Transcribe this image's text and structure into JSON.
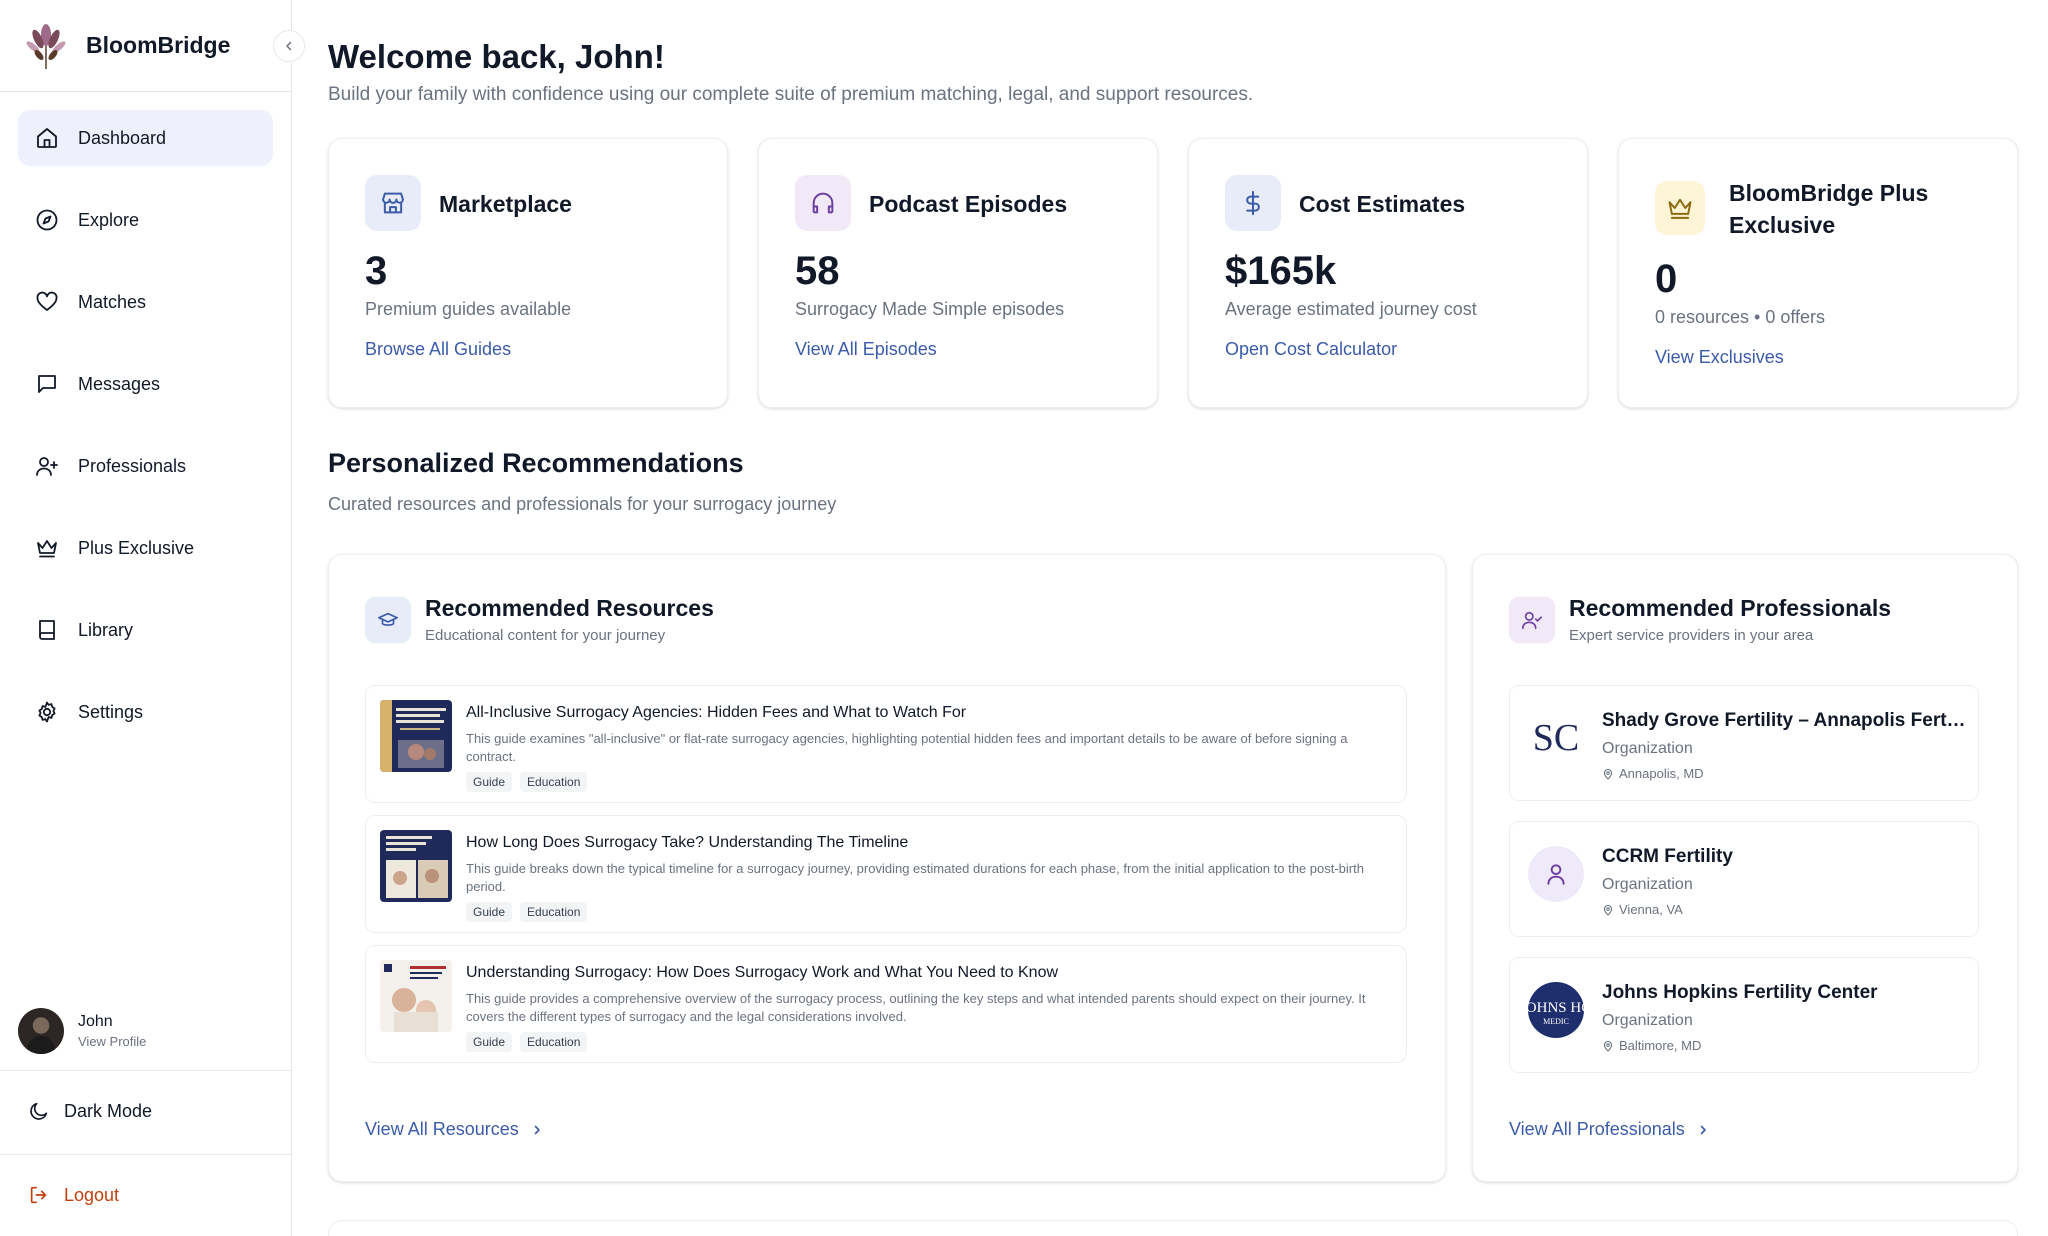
{
  "brand": {
    "name": "BloomBridge"
  },
  "nav": [
    {
      "label": "Dashboard",
      "icon": "home-icon",
      "active": true
    },
    {
      "label": "Explore",
      "icon": "compass-icon"
    },
    {
      "label": "Matches",
      "icon": "heart-icon"
    },
    {
      "label": "Messages",
      "icon": "message-icon"
    },
    {
      "label": "Professionals",
      "icon": "user-plus-icon"
    },
    {
      "label": "Plus Exclusive",
      "icon": "crown-icon"
    },
    {
      "label": "Library",
      "icon": "book-icon"
    },
    {
      "label": "Settings",
      "icon": "gear-icon"
    }
  ],
  "profile": {
    "name": "John",
    "sub": "View Profile"
  },
  "dark_mode_label": "Dark Mode",
  "logout_label": "Logout",
  "header": {
    "title": "Welcome back, John!",
    "subtitle": "Build your family with confidence using our complete suite of premium matching, legal, and support resources."
  },
  "stats": [
    {
      "title": "Marketplace",
      "value": "3",
      "desc": "Premium guides available",
      "link": "Browse All Guides",
      "icon": "store-icon"
    },
    {
      "title": "Podcast Episodes",
      "value": "58",
      "desc": "Surrogacy Made Simple episodes",
      "link": "View All Episodes",
      "icon": "headphones-icon"
    },
    {
      "title": "Cost Estimates",
      "value": "$165k",
      "desc": "Average estimated journey cost",
      "link": "Open Cost Calculator",
      "icon": "dollar-icon"
    },
    {
      "title": "BloomBridge Plus Exclusive",
      "value": "0",
      "desc": "0 resources • 0 offers",
      "link": "View Exclusives",
      "icon": "crown-icon"
    }
  ],
  "recommendations": {
    "title": "Personalized Recommendations",
    "subtitle": "Curated resources and professionals for your surrogacy journey"
  },
  "resources": {
    "title": "Recommended Resources",
    "subtitle": "Educational content for your journey",
    "items": [
      {
        "title": "All-Inclusive Surrogacy Agencies: Hidden Fees and What to Watch For",
        "desc": "This guide examines \"all-inclusive\" or flat-rate surrogacy agencies, highlighting potential hidden fees and important details to be aware of before signing a contract.",
        "tags": [
          "Guide",
          "Education"
        ]
      },
      {
        "title": "How Long Does Surrogacy Take? Understanding The Timeline",
        "desc": "This guide breaks down the typical timeline for a surrogacy journey, providing estimated durations for each phase, from the initial application to the post-birth period.",
        "tags": [
          "Guide",
          "Education"
        ]
      },
      {
        "title": "Understanding Surrogacy: How Does Surrogacy Work and What You Need to Know",
        "desc": "This guide provides a comprehensive overview of the surrogacy process, outlining the key steps and what intended parents should expect on their journey. It covers the different types of surrogacy and the legal considerations involved.",
        "tags": [
          "Guide",
          "Education"
        ]
      }
    ],
    "link": "View All Resources"
  },
  "professionals": {
    "title": "Recommended Professionals",
    "subtitle": "Expert service providers in your area",
    "items": [
      {
        "name": "Shady Grove Fertility – Annapolis Fertility Center",
        "type": "Organization",
        "location": "Annapolis, MD",
        "logo_text": "SC"
      },
      {
        "name": "CCRM Fertility",
        "type": "Organization",
        "location": "Vienna, VA"
      },
      {
        "name": "Johns Hopkins Fertility Center",
        "type": "Organization",
        "location": "Baltimore, MD",
        "logo_text": "JOHNS HO",
        "logo_sub": "MEDIC"
      }
    ],
    "link": "View All Professionals"
  },
  "colors": {
    "accent": "#3b5ba9",
    "active_nav": "#eef1fb",
    "logout": "#c2410c"
  }
}
